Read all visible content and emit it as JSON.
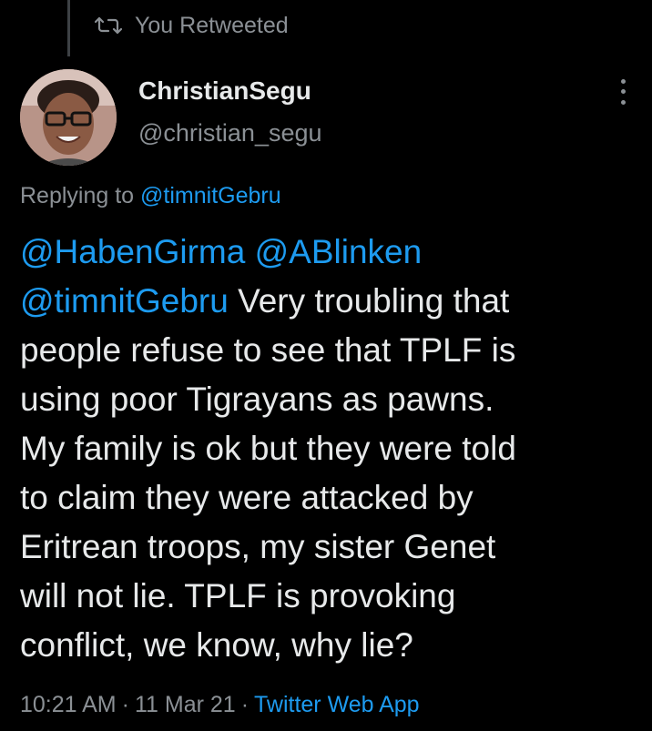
{
  "retweet": {
    "label": "You Retweeted",
    "icon": "retweet-icon"
  },
  "author": {
    "display_name": "ChristianSegu",
    "handle": "@christian_segu",
    "avatar": "avatar"
  },
  "menu": {
    "icon": "more-vertical-icon"
  },
  "replying": {
    "prefix": "Replying to ",
    "to": "@timnitGebru"
  },
  "tweet": {
    "lines": [
      {
        "mentions": [
          "@HabenGirma",
          " ",
          "@ABlinken"
        ],
        "text": ""
      },
      {
        "mention": "@timnitGebru",
        "text": " Very troubling that"
      },
      {
        "text": "people refuse to see that TPLF is"
      },
      {
        "text": "using poor Tigrayans as pawns."
      },
      {
        "text": "My family is ok but they were told"
      },
      {
        "text": "to claim they were attacked by"
      },
      {
        "text": "Eritrean troops, my sister Genet"
      },
      {
        "text": "will not lie. TPLF is provoking"
      },
      {
        "text": "conflict, we know, why lie?"
      }
    ]
  },
  "meta": {
    "time": "10:21 AM",
    "date": "11 Mar 21",
    "separator": "·",
    "source": "Twitter Web App"
  },
  "colors": {
    "background": "#000000",
    "text": "#e7e9ea",
    "muted": "#8b9095",
    "link": "#1d9bf0"
  }
}
